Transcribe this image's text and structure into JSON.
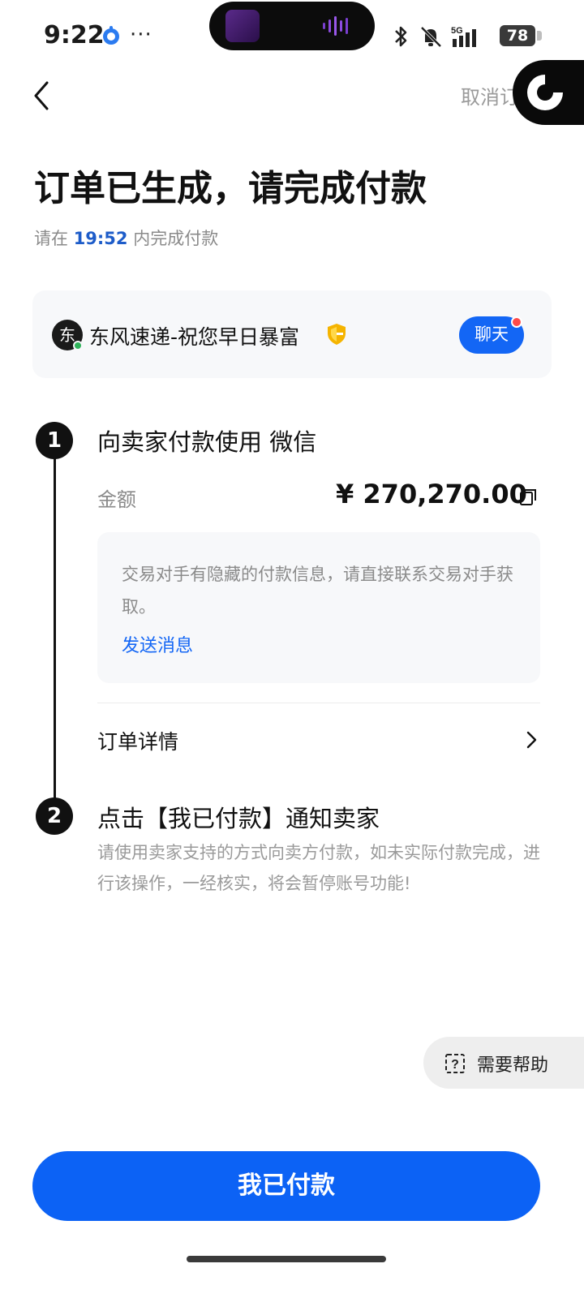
{
  "status_bar": {
    "time": "9:22",
    "more": "···",
    "network": "5G",
    "battery": "78",
    "icons": [
      "app-notification-icon",
      "bluetooth-icon",
      "mute-icon",
      "signal-icon",
      "battery-icon"
    ]
  },
  "header": {
    "back_icon": "chevron-left-icon",
    "cancel_label": "取消订单"
  },
  "page": {
    "title": "订单已生成，请完成付款",
    "deadline_prefix": "请在 ",
    "deadline_time": "19:52",
    "deadline_suffix": " 内完成付款"
  },
  "seller": {
    "avatar_char": "东",
    "name": "东风速递-祝您早日暴富",
    "verified_icon": "shield-icon",
    "chat_label": "聊天"
  },
  "step1": {
    "number": "1",
    "title": "向卖家付款使用 微信",
    "amount_label": "金额",
    "amount_value": "¥ 270,270.00",
    "info_text": "交易对手有隐藏的付款信息，请直接联系交易对手获取。",
    "send_message_label": "发送消息",
    "order_detail_label": "订单详情"
  },
  "step2": {
    "number": "2",
    "title": "点击【我已付款】通知卖家",
    "description": "请使用卖家支持的方式向卖方付款，如未实际付款完成，进行该操作，一经核实，将会暂停账号功能!"
  },
  "help": {
    "label": "需要帮助"
  },
  "primary_button": {
    "label": "我已付款"
  },
  "colors": {
    "accent": "#0c62f5",
    "link": "#1366f5",
    "time_highlight": "#1d5cc9",
    "chat_badge": "#ff4a4a",
    "online": "#2fb35a"
  }
}
